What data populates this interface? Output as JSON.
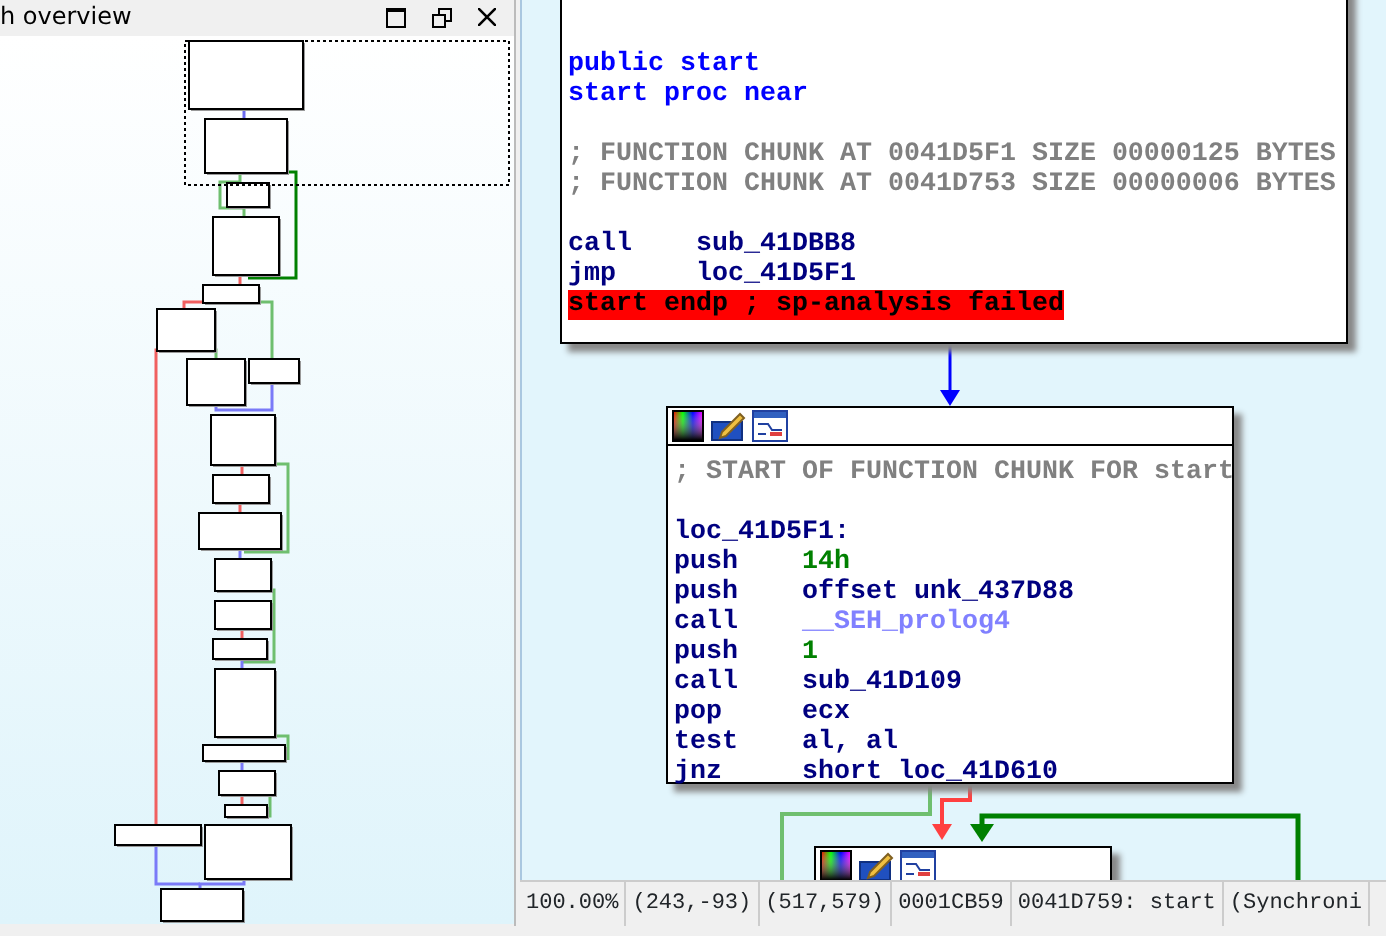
{
  "overview_panel": {
    "title": "h overview"
  },
  "blocks": [
    {
      "toolbar": false,
      "lines": [
        {
          "kind": "keyword",
          "text": "public start"
        },
        {
          "kind": "keyword",
          "text": "start proc near"
        },
        {
          "kind": "blank"
        },
        {
          "kind": "comment",
          "text": "; FUNCTION CHUNK AT 0041D5F1 SIZE 00000125 BYTES"
        },
        {
          "kind": "comment",
          "text": "; FUNCTION CHUNK AT 0041D753 SIZE 00000006 BYTES"
        },
        {
          "kind": "blank"
        },
        {
          "kind": "insn",
          "mnemonic": "call",
          "operand": {
            "kind": "name",
            "text": "sub_41DBB8"
          }
        },
        {
          "kind": "insn",
          "mnemonic": "jmp",
          "operand": {
            "kind": "name",
            "text": "loc_41D5F1"
          }
        },
        {
          "kind": "error",
          "text": "start endp ; sp-analysis failed"
        }
      ]
    },
    {
      "toolbar": true,
      "lines": [
        {
          "kind": "comment",
          "text": "; START OF FUNCTION CHUNK FOR start"
        },
        {
          "kind": "blank"
        },
        {
          "kind": "label",
          "text": "loc_41D5F1:"
        },
        {
          "kind": "insn",
          "mnemonic": "push",
          "operand": {
            "kind": "number",
            "text": "14h"
          }
        },
        {
          "kind": "insn",
          "mnemonic": "push",
          "operand": {
            "kind": "name",
            "text": "offset unk_437D88"
          }
        },
        {
          "kind": "insn",
          "mnemonic": "call",
          "operand": {
            "kind": "import",
            "text": "__SEH_prolog4"
          }
        },
        {
          "kind": "insn",
          "mnemonic": "push",
          "operand": {
            "kind": "number",
            "text": "1"
          }
        },
        {
          "kind": "insn",
          "mnemonic": "call",
          "operand": {
            "kind": "name",
            "text": "sub_41D109"
          }
        },
        {
          "kind": "insn",
          "mnemonic": "pop",
          "operand": {
            "kind": "name",
            "text": "ecx"
          }
        },
        {
          "kind": "insn",
          "mnemonic": "test",
          "operand": {
            "kind": "name",
            "text": "al, al"
          }
        },
        {
          "kind": "insn",
          "mnemonic": "jnz",
          "operand": {
            "kind": "name",
            "text": "short loc_41D610"
          }
        }
      ]
    },
    {
      "toolbar": true
    }
  ],
  "status_bar": [
    "100.00%",
    "(243,-93)",
    "(517,579)",
    "0001CB59",
    "0041D759: start",
    "(Synchroni"
  ]
}
